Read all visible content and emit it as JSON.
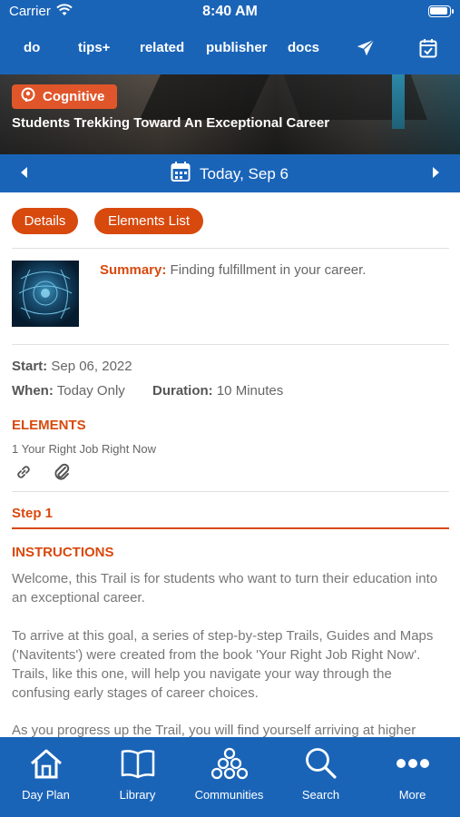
{
  "status": {
    "carrier": "Carrier",
    "time": "8:40 AM"
  },
  "top_nav": {
    "tabs": [
      "do",
      "tips+",
      "related",
      "publisher",
      "docs"
    ]
  },
  "hero": {
    "badge": "Cognitive",
    "title": "Students Trekking Toward An Exceptional Career"
  },
  "date_bar": {
    "label": "Today, Sep 6"
  },
  "buttons": {
    "details": "Details",
    "elements_list": "Elements List"
  },
  "summary": {
    "label": "Summary:",
    "text": "Finding fulfillment in your career."
  },
  "meta": {
    "start_label": "Start:",
    "start_value": "Sep 06, 2022",
    "when_label": "When:",
    "when_value": "Today Only",
    "duration_label": "Duration:",
    "duration_value": "10 Minutes"
  },
  "elements": {
    "heading": "ELEMENTS",
    "item": "1 Your Right Job Right Now"
  },
  "step": {
    "label": "Step 1"
  },
  "instructions": {
    "heading": "INSTRUCTIONS",
    "p1": "Welcome, this Trail is for students who want to turn their education into an exceptional career.",
    "p2": "To arrive at this goal, a series of step-by-step Trails, Guides and Maps ('Navitents') were created from the book 'Your Right Job Right Now'. Trails, like this one, will help you navigate your way through the confusing early stages of career choices.",
    "p3": "As you progress up the Trail, you will find yourself arriving at higher"
  },
  "bottom_nav": {
    "day_plan": "Day Plan",
    "library": "Library",
    "communities": "Communities",
    "search": "Search",
    "more": "More"
  },
  "colors": {
    "brand_blue": "#1a64b8",
    "accent_orange": "#d8490d",
    "badge_orange": "#e0562a"
  }
}
